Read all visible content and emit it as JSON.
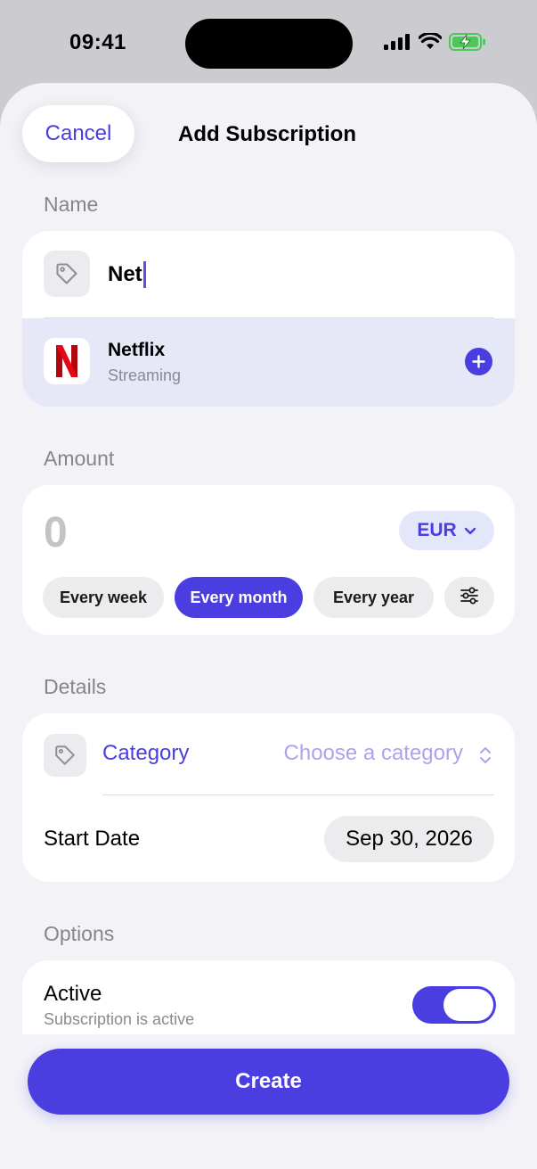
{
  "status_bar": {
    "time": "09:41"
  },
  "header": {
    "cancel_label": "Cancel",
    "title": "Add Subscription"
  },
  "name_section": {
    "label": "Name",
    "input_value": "Net",
    "suggestion": {
      "name": "Netflix",
      "category": "Streaming",
      "logo_letter": "N"
    }
  },
  "amount_section": {
    "label": "Amount",
    "value": "0",
    "currency": "EUR",
    "frequencies": [
      {
        "label": "Every week",
        "active": false
      },
      {
        "label": "Every month",
        "active": true
      },
      {
        "label": "Every year",
        "active": false
      }
    ]
  },
  "details_section": {
    "label": "Details",
    "category_label": "Category",
    "category_placeholder": "Choose a category",
    "start_date_label": "Start Date",
    "start_date_value": "Sep 30, 2026"
  },
  "options_section": {
    "label": "Options",
    "active_label": "Active",
    "active_subtitle": "Subscription is active",
    "active_on": true
  },
  "footer": {
    "create_label": "Create"
  },
  "colors": {
    "accent": "#4a3ee0",
    "netflix_red": "#e50914",
    "background": "#f2f2f7"
  },
  "icons": [
    "tag-icon",
    "plus-circle-icon",
    "chevron-down-icon",
    "sliders-icon",
    "chevron-up-down-icon",
    "signal-icon",
    "wifi-icon",
    "battery-charging-icon"
  ]
}
